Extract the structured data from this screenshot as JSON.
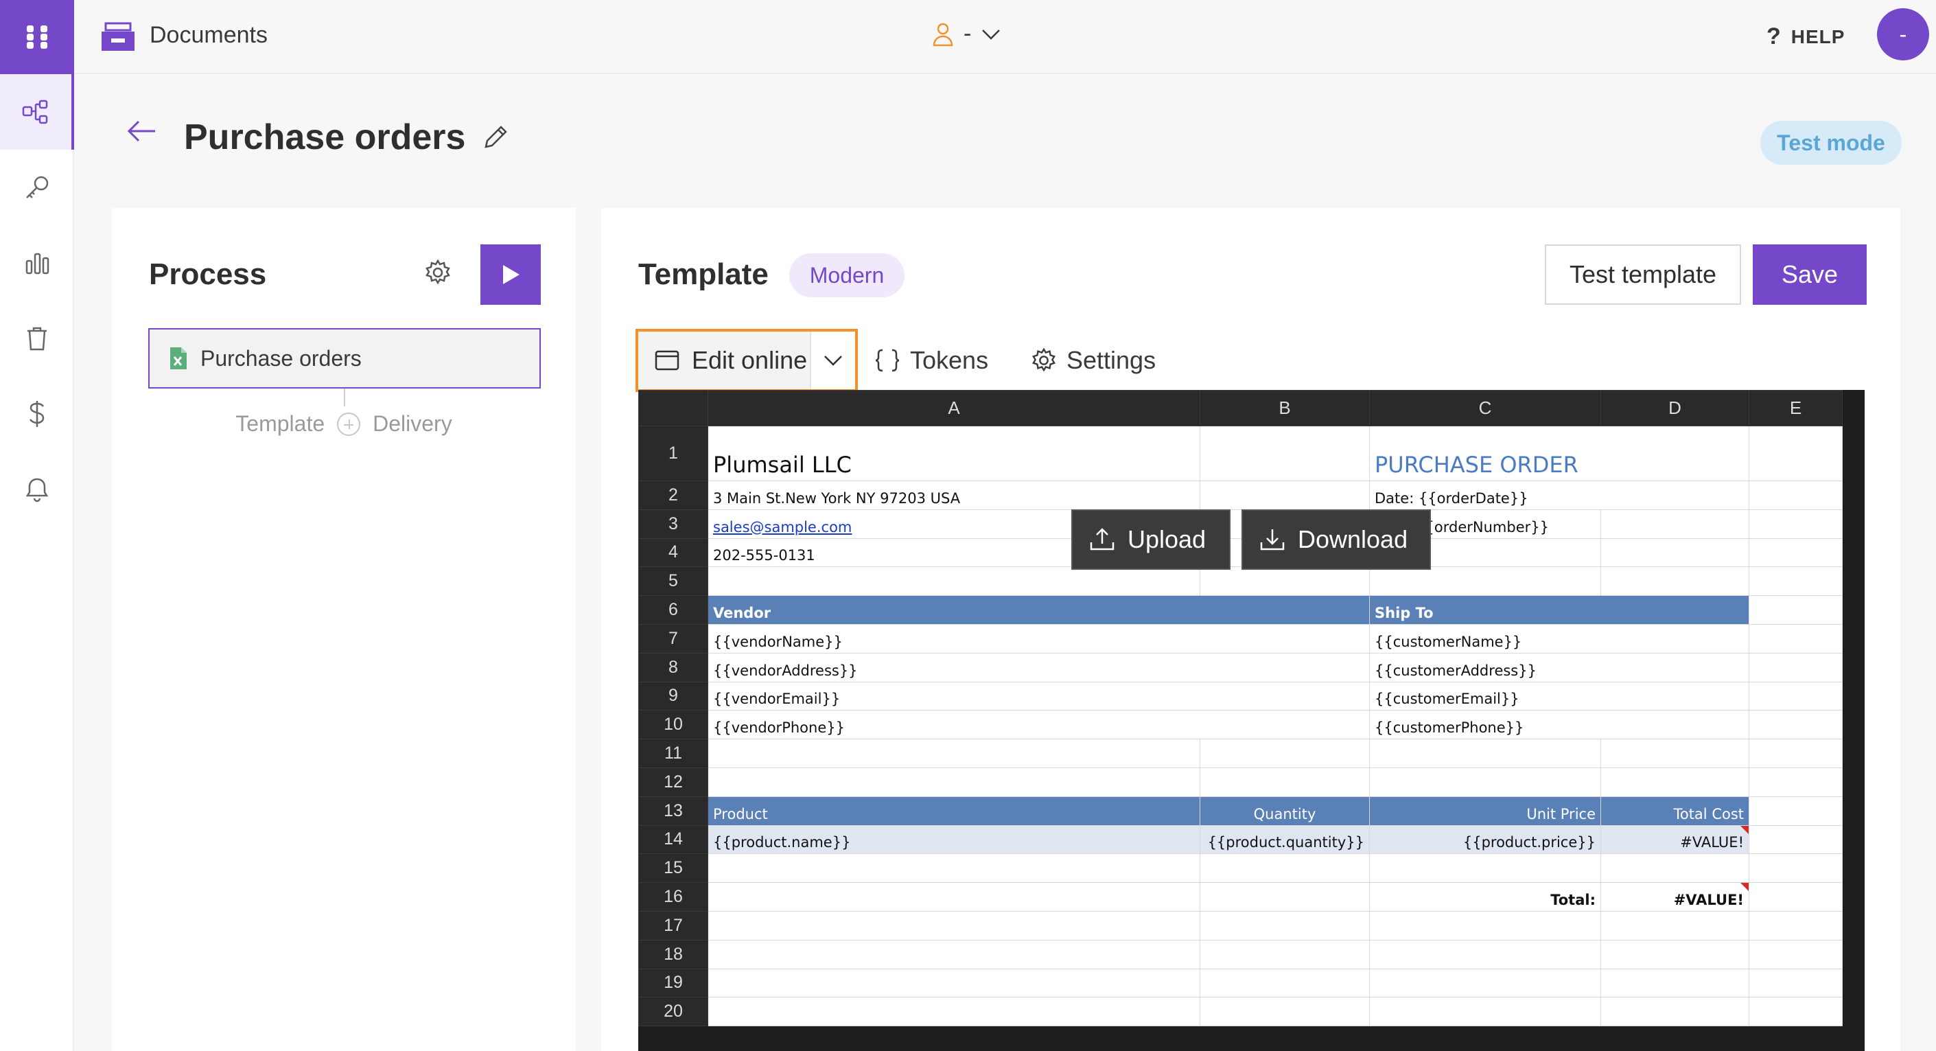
{
  "app": {
    "title": "Documents",
    "user_name": "-",
    "help_label": "HELP",
    "avatar_initial": "-"
  },
  "page": {
    "title": "Purchase orders",
    "mode_badge": "Test mode"
  },
  "rail": {
    "items": [
      "flows-icon",
      "key-icon",
      "chart-icon",
      "trash-icon",
      "dollar-icon",
      "bell-icon"
    ]
  },
  "process": {
    "title": "Process",
    "item_label": "Purchase orders",
    "sub_left": "Template",
    "sub_right": "Delivery"
  },
  "template": {
    "title": "Template",
    "badge": "Modern",
    "test_button": "Test template",
    "save_button": "Save",
    "tabs": {
      "edit_online": "Edit online",
      "tokens": "Tokens",
      "settings": "Settings"
    },
    "upload_button": "Upload",
    "download_button": "Download"
  },
  "sheet": {
    "columns": [
      "A",
      "B",
      "C",
      "D",
      "E"
    ],
    "rows": [
      "1",
      "2",
      "3",
      "4",
      "5",
      "6",
      "7",
      "8",
      "9",
      "10",
      "11",
      "12",
      "13",
      "14",
      "15",
      "16",
      "17",
      "18",
      "19",
      "20"
    ],
    "company": "Plumsail LLC",
    "address": "3 Main St.New York NY 97203 USA",
    "email": "sales@sample.com",
    "phone": "202-555-0131",
    "po_title": "PURCHASE ORDER",
    "date": "Date: {{orderDate}}",
    "po_number": "PO: #{{orderNumber}}",
    "vendor_header": "Vendor",
    "shipto_header": "Ship To",
    "vendor_name": "{{vendorName}}",
    "vendor_address": "{{vendorAddress}}",
    "vendor_email": "{{vendorEmail}}",
    "vendor_phone": "{{vendorPhone}}",
    "customer_name": "{{customerName}}",
    "customer_address": "{{customerAddress}}",
    "customer_email": "{{customerEmail}}",
    "customer_phone": "{{customerPhone}}",
    "col_product": "Product",
    "col_quantity": "Quantity",
    "col_unit_price": "Unit Price",
    "col_total_cost": "Total Cost",
    "product_name": "{{product.name}}",
    "product_quantity": "{{product.quantity}}",
    "product_price": "{{product.price}}",
    "line_total": "#VALUE!",
    "total_label": "Total:",
    "total_value": "#VALUE!"
  },
  "colors": {
    "accent": "#7448c9",
    "highlight": "#f0932b",
    "band": "#5a80b8",
    "test_mode_bg": "#d6ebf7"
  }
}
